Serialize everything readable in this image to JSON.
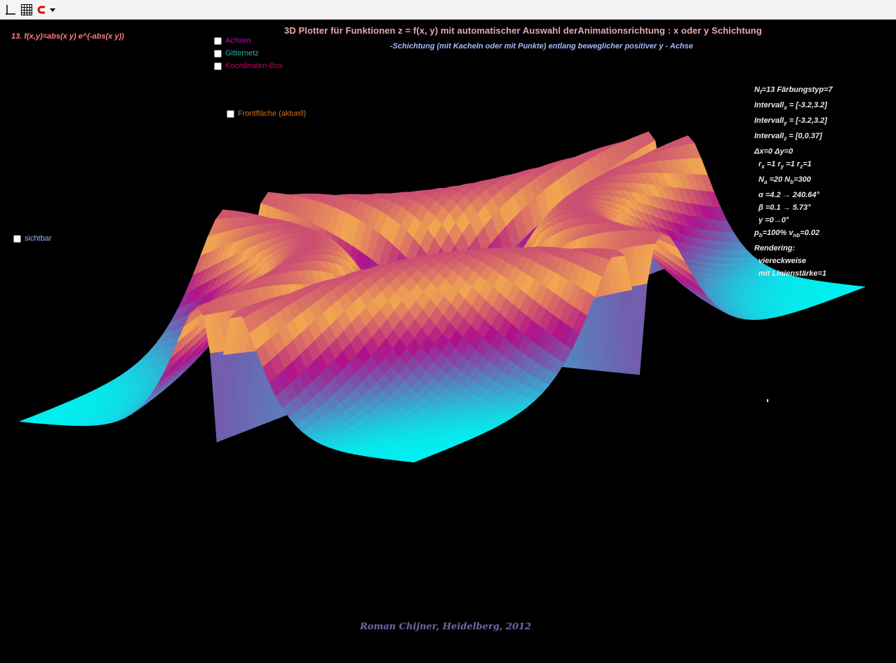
{
  "toolbar": {
    "tools": [
      {
        "icon": "axes-icon"
      },
      {
        "icon": "grid-icon"
      },
      {
        "icon": "magnet-icon"
      },
      {
        "icon": "dropdown-arrow-icon"
      }
    ]
  },
  "function_label": "13. f(x,y)=abs(x y) e^(-abs(x y))",
  "title": "3D Plotter für Funktionen z = f(x, y) mit automatischer Auswahl derAnimationsrichtung :  x oder y Schichtung",
  "subtitle": "-Schichtung (mit Kacheln oder mit Punkte) entlang beweglicher  positiver  y - Achse",
  "checkboxes": {
    "achsen": {
      "label": "Achsen",
      "color": "#c000c0",
      "checked": false
    },
    "gitternetz": {
      "label": "Gitternetz",
      "color": "#20b0b0",
      "checked": false
    },
    "koordinaten_box": {
      "label": "Koordinaten-Box",
      "color": "#c00060",
      "checked": false
    },
    "frontflaeche": {
      "label": "Frontfläche (aktuell)",
      "color": "#d07020",
      "checked": false
    },
    "sichtbar": {
      "label": "sichtbar",
      "color": "#9ab8ff",
      "checked": false
    }
  },
  "info": {
    "nf_base": "N",
    "nf_sub": "f",
    "nf_rest": "=13  Färbungstyp=7",
    "ix_base": "Intervall",
    "ix_sub": "x",
    "ix_rest": " = [-3.2,3.2]",
    "iy_base": "Intervall",
    "iy_sub": "y",
    "iy_rest": " = [-3.2,3.2]",
    "iz_base": "Intervall",
    "iz_sub": "z",
    "iz_rest": " = [0,0.37]",
    "delta": "Δx=0      Δy=0",
    "r_x": "r",
    "r_x_sub": "x",
    "r_x_rest": " =1  r",
    "r_y_sub": "y",
    "r_y_rest": " =1  r",
    "r_z_sub": "z",
    "r_z_rest": "=1",
    "na_base": "N",
    "na_sub": "a",
    "na_rest": " =20   N",
    "nb_sub": "b",
    "nb_rest": "=300",
    "alpha": "α =4.2 → 240.64°",
    "beta": "β =0.1 → 5.73°",
    "gamma": "γ =0→0°",
    "pb_base": "p",
    "pb_sub": "b",
    "pb_rest": "=100%   v",
    "vnb_sub": "nb",
    "vnb_rest": "=0.02",
    "rendering": "Rendering:",
    "mode": "viereckweise",
    "linewidth": "mit Linienstärke=1"
  },
  "footer": "Roman Chijner,  Heidelberg,  2012",
  "colors": {
    "background": "#000000",
    "surface_low": "#00f0f0",
    "surface_mid": "#b0108a",
    "surface_high": "#f2a850"
  }
}
